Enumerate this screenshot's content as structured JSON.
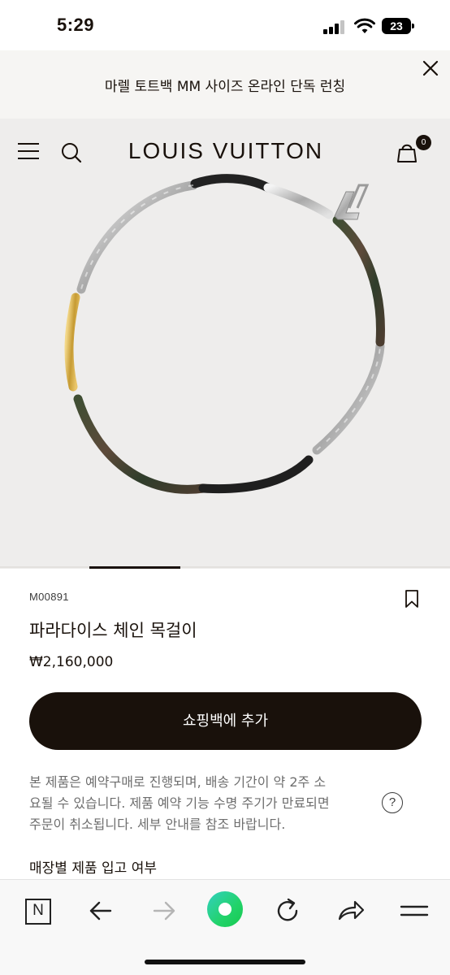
{
  "status_bar": {
    "time": "5:29",
    "battery": "23"
  },
  "announcement": {
    "text": "마렐 토트백 MM 사이즈 온라인 단독 런칭",
    "close_icon": "close-icon"
  },
  "header": {
    "brand": "LOUIS VUITTON",
    "bag_count": "0",
    "icons": [
      "menu-icon",
      "search-icon",
      "shopping-bag-icon"
    ]
  },
  "product": {
    "sku": "M00891",
    "name": "파라다이스 체인 목걸이",
    "price": "₩2,160,000",
    "add_to_bag_label": "쇼핑백에 추가",
    "notice_lines": [
      "본 제품은 예약구매로 진행되며, 배송 기간이 약 2주 소",
      "요될 수 있습니다. 제품 예약 기능 수명 주기가 만료되면",
      "주문이 취소됩니다. 세부 안내를 참조 바랍니다."
    ],
    "help_label": "?",
    "store_availability_title": "매장별 제품 입고 여부"
  },
  "carousel": {
    "active_index": 1
  },
  "browser_toolbar": {
    "n_label": "N",
    "icons": [
      "n-icon",
      "back-arrow-icon",
      "forward-arrow-icon",
      "home-circle-icon",
      "reload-icon",
      "share-icon",
      "hamburger-menu-icon"
    ]
  },
  "colors": {
    "text": "#19110b",
    "announcement_bg": "#f6f5f3",
    "hero_bg": "#eeedec",
    "button_bg": "#19110b",
    "notice_text": "#6e6e6e",
    "accent_green": "#22d36a"
  }
}
